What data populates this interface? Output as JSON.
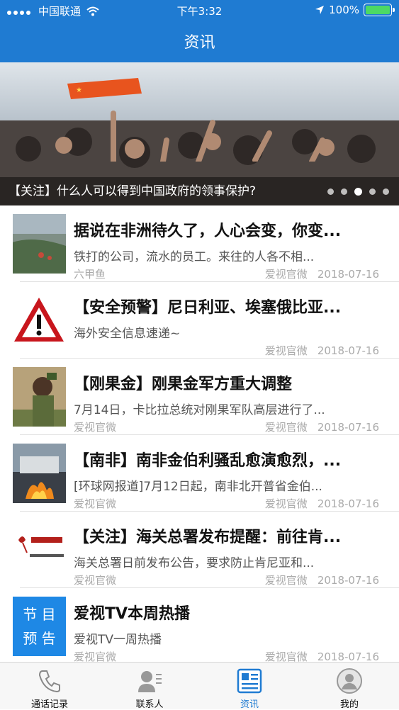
{
  "status_bar": {
    "carrier": "中国联通",
    "time": "下午3:32",
    "battery": "100%"
  },
  "header": {
    "title": "资讯"
  },
  "banner": {
    "caption": "【关注】什么人可以得到中国政府的领事保护?",
    "pages": 5,
    "active_page": 3
  },
  "articles": [
    {
      "title": "据说在非洲待久了，人心会变，你变...",
      "summary": "铁打的公司，流水的员工。来往的人各不相...",
      "source": "六甲鱼",
      "publisher": "爱视官微",
      "date": "2018-07-16",
      "thumb": "aerial-photo"
    },
    {
      "title": "【安全预警】尼日利亚、埃塞俄比亚...",
      "summary": "海外安全信息速递~",
      "source": "",
      "publisher": "爱视官微",
      "date": "2018-07-16",
      "thumb": "warning-sign"
    },
    {
      "title": "【刚果金】刚果金军方重大调整",
      "summary": "7月14日，卡比拉总统对刚果军队高层进行了...",
      "source": "爱视官微",
      "publisher": "爱视官微",
      "date": "2018-07-16",
      "thumb": "soldier-photo"
    },
    {
      "title": "【南非】南非金伯利骚乱愈演愈烈，...",
      "summary": "[环球网报道]7月12日起，南非北开普省金伯...",
      "source": "爱视官微",
      "publisher": "爱视官微",
      "date": "2018-07-16",
      "thumb": "fire-photo"
    },
    {
      "title": "【关注】海关总署发布提醒：前往肯...",
      "summary": "海关总署日前发布公告，要求防止肯尼亚和...",
      "source": "爱视官微",
      "publisher": "爱视官微",
      "date": "2018-07-16",
      "thumb": "customs-logo"
    },
    {
      "title": "爱视TV本周热播",
      "summary": "爱视TV一周热播",
      "source": "爱视官微",
      "publisher": "爱视官微",
      "date": "2018-07-16",
      "thumb": "program-card",
      "thumb_text": "节 目\n预 告"
    }
  ],
  "tabs": [
    {
      "label": "通话记录",
      "icon": "phone-icon",
      "active": false
    },
    {
      "label": "联系人",
      "icon": "contacts-icon",
      "active": false
    },
    {
      "label": "资讯",
      "icon": "news-icon",
      "active": true
    },
    {
      "label": "我的",
      "icon": "profile-icon",
      "active": false
    }
  ],
  "colors": {
    "accent": "#1f7bd2",
    "program_card": "#1e88e5"
  }
}
